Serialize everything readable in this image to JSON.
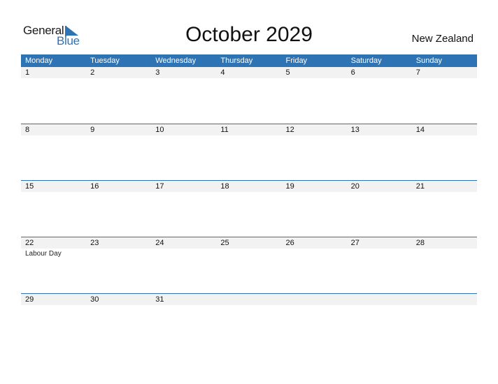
{
  "logo": {
    "word1": "General",
    "word2": "Blue"
  },
  "title": "October 2029",
  "country": "New Zealand",
  "colors": {
    "accent": "#2E74B5",
    "stripe": "#f2f2f2"
  },
  "weekdays": [
    "Monday",
    "Tuesday",
    "Wednesday",
    "Thursday",
    "Friday",
    "Saturday",
    "Sunday"
  ],
  "weeks": [
    {
      "days": [
        "1",
        "2",
        "3",
        "4",
        "5",
        "6",
        "7"
      ],
      "events": [
        "",
        "",
        "",
        "",
        "",
        "",
        ""
      ]
    },
    {
      "days": [
        "8",
        "9",
        "10",
        "11",
        "12",
        "13",
        "14"
      ],
      "events": [
        "",
        "",
        "",
        "",
        "",
        "",
        ""
      ]
    },
    {
      "days": [
        "15",
        "16",
        "17",
        "18",
        "19",
        "20",
        "21"
      ],
      "events": [
        "",
        "",
        "",
        "",
        "",
        "",
        ""
      ]
    },
    {
      "days": [
        "22",
        "23",
        "24",
        "25",
        "26",
        "27",
        "28"
      ],
      "events": [
        "Labour Day",
        "",
        "",
        "",
        "",
        "",
        ""
      ]
    },
    {
      "days": [
        "29",
        "30",
        "31",
        "",
        "",
        "",
        ""
      ],
      "events": [
        "",
        "",
        "",
        "",
        "",
        "",
        ""
      ]
    }
  ]
}
